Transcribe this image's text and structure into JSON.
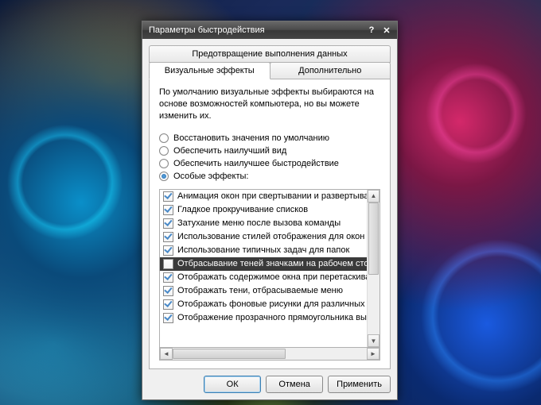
{
  "window": {
    "title": "Параметры быстродействия"
  },
  "tabs": {
    "dep": "Предотвращение выполнения данных",
    "visual": "Визуальные эффекты",
    "advanced": "Дополнительно"
  },
  "description": "По умолчанию визуальные эффекты выбираются на основе возможностей компьютера, но вы можете изменить их.",
  "radios": [
    {
      "label": "Восстановить значения по умолчанию",
      "checked": false
    },
    {
      "label": "Обеспечить наилучший вид",
      "checked": false
    },
    {
      "label": "Обеспечить наилучшее быстродействие",
      "checked": false
    },
    {
      "label": "Особые эффекты:",
      "checked": true
    }
  ],
  "effects": [
    {
      "label": "Анимация окон при свертывании и развертывании",
      "checked": true,
      "selected": false
    },
    {
      "label": "Гладкое прокручивание списков",
      "checked": true,
      "selected": false
    },
    {
      "label": "Затухание меню после вызова команды",
      "checked": true,
      "selected": false
    },
    {
      "label": "Использование стилей отображения для окон и кнопок",
      "checked": true,
      "selected": false
    },
    {
      "label": "Использование типичных задач для папок",
      "checked": true,
      "selected": false
    },
    {
      "label": "Отбрасывание теней значками на рабочем столе",
      "checked": false,
      "selected": true
    },
    {
      "label": "Отображать содержимое окна при перетаскивании",
      "checked": true,
      "selected": false
    },
    {
      "label": "Отображать тени, отбрасываемые меню",
      "checked": true,
      "selected": false
    },
    {
      "label": "Отображать фоновые рисунки для различных типов папок",
      "checked": true,
      "selected": false
    },
    {
      "label": "Отображение прозрачного прямоугольника выделения",
      "checked": true,
      "selected": false
    }
  ],
  "buttons": {
    "ok": "ОК",
    "cancel": "Отмена",
    "apply": "Применить"
  }
}
